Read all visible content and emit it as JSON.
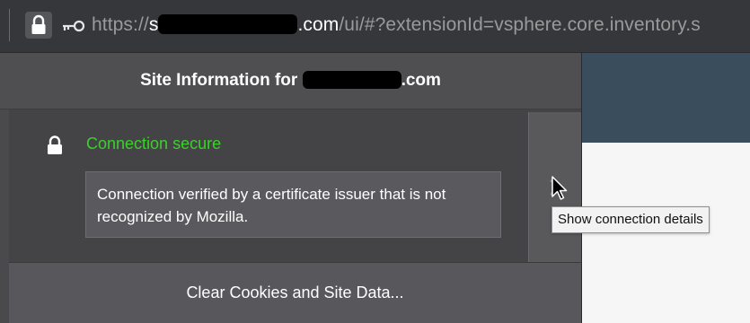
{
  "url_bar": {
    "scheme": "https://",
    "host_prefix_visible": "s",
    "host_suffix_visible": ".com",
    "path": "/ui/#?extensionId=vsphere.core.inventory.s"
  },
  "site_info": {
    "title_prefix": "Site Information for",
    "title_suffix": ".com",
    "status": "Connection secure",
    "status_color": "#3bd12a",
    "certificate_note": "Connection verified by a certificate issuer that is not recognized by Mozilla.",
    "clear_button": "Clear Cookies and Site Data..."
  },
  "tooltip": {
    "text": "Show connection details"
  },
  "icons": [
    "lock-icon",
    "key-icon",
    "chevron-right-icon",
    "mouse-cursor-icon"
  ]
}
